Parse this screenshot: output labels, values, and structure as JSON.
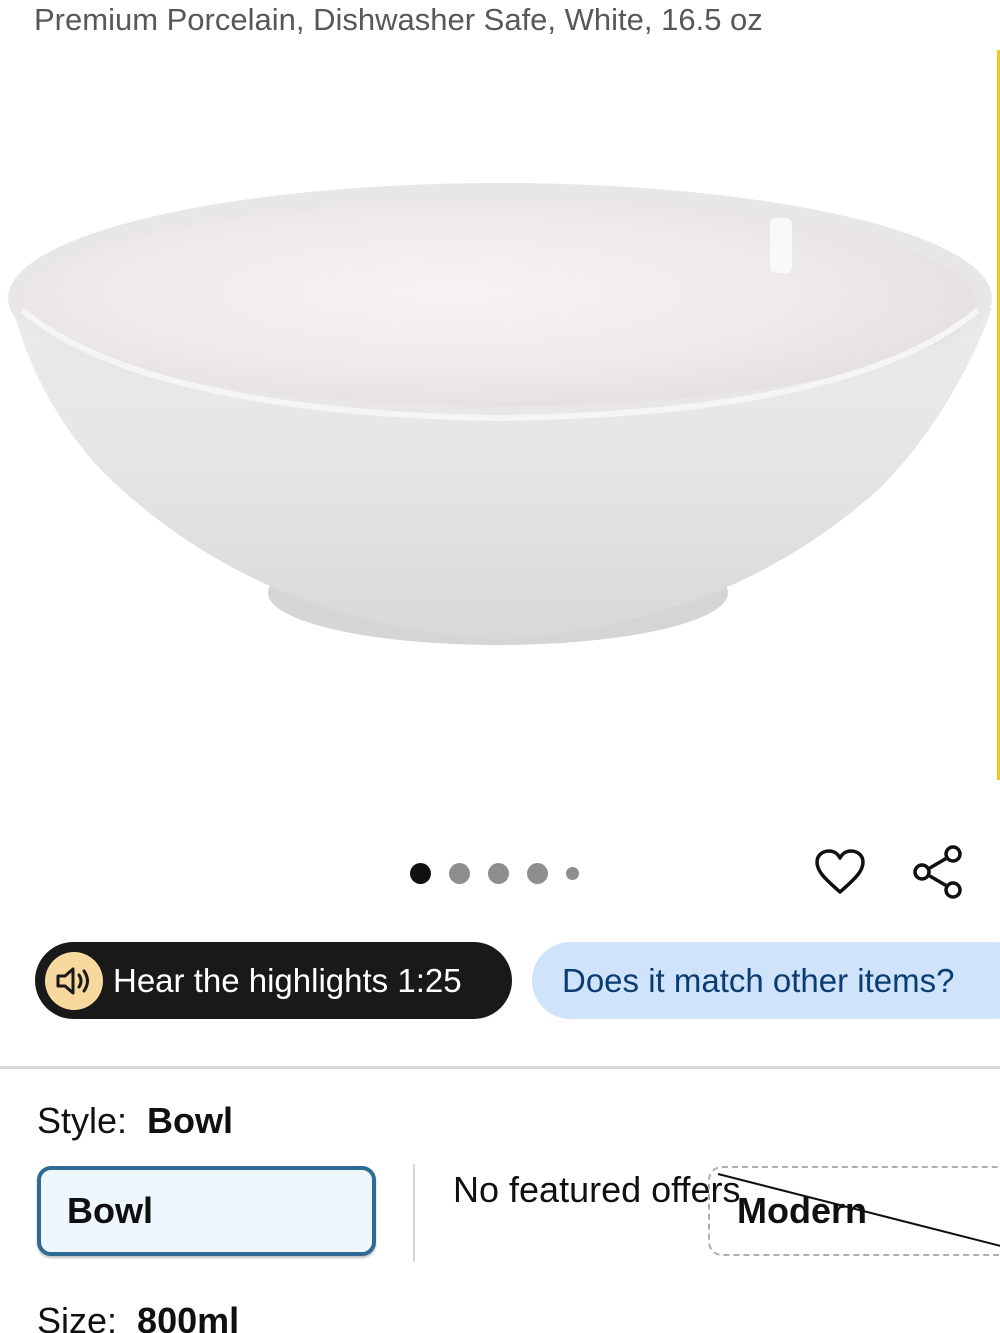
{
  "product": {
    "subtitle": "Premium Porcelain, Dishwasher Safe, White, 16.5 oz"
  },
  "gallery": {
    "image_count": 5,
    "active_index": 0
  },
  "actions": {
    "wishlist_icon": "heart-icon",
    "share_icon": "share-icon"
  },
  "pills": {
    "hear_label": "Hear the highlights 1:25",
    "match_label": "Does it match other items?"
  },
  "variations": {
    "style_label": "Style:",
    "style_value": "Bowl",
    "options": {
      "selected": "Bowl",
      "no_offers": "No featured offers",
      "unavailable": "Modern"
    },
    "size_label": "Size:",
    "size_value": "800ml"
  },
  "colors": {
    "accent_border": "#2f6a95",
    "match_pill_bg": "#cfe3fb",
    "hear_pill_bg": "#191919"
  }
}
